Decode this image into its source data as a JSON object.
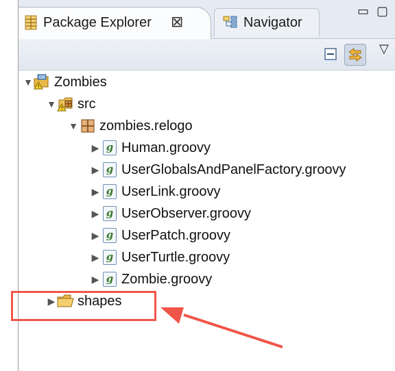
{
  "tabs": {
    "active": {
      "label": "Package Explorer",
      "close_glyph": "⊠",
      "icon": "package-explorer-icon"
    },
    "inactive": {
      "label": "Navigator",
      "icon": "navigator-icon"
    }
  },
  "window_controls": {
    "minimize": "▭",
    "maximize": "▢"
  },
  "toolbar": {
    "collapse_all_icon": "collapse-all-icon",
    "link_editor_icon": "link-with-editor-icon",
    "view_menu_glyph": "▽"
  },
  "tree": {
    "project": {
      "label": "Zombies",
      "icon": "project-icon"
    },
    "source_folder": {
      "label": "src",
      "icon": "source-folder-icon"
    },
    "package": {
      "label": "zombies.relogo",
      "icon": "package-icon"
    },
    "files": [
      "Human.groovy",
      "UserGlobalsAndPanelFactory.groovy",
      "UserLink.groovy",
      "UserObserver.groovy",
      "UserPatch.groovy",
      "UserTurtle.groovy",
      "Zombie.groovy"
    ],
    "folder": {
      "label": "shapes",
      "icon": "folder-icon"
    }
  },
  "annotation": {
    "highlight_color": "#f0554a",
    "arrow_color": "#f0554a"
  },
  "colors": {
    "tab_bar": "#e6ebf3",
    "groovy_g": "#3b7a2e",
    "package_brown": "#8b5a2b"
  }
}
